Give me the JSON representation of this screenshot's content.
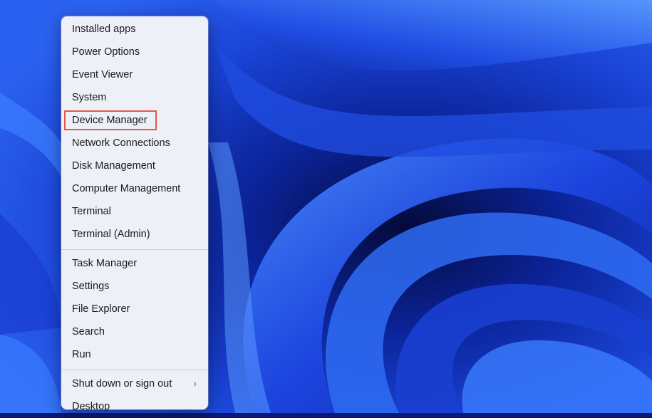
{
  "context_menu": {
    "group_1": [
      {
        "label": "Installed apps"
      },
      {
        "label": "Power Options"
      },
      {
        "label": "Event Viewer"
      },
      {
        "label": "System"
      },
      {
        "label": "Device Manager"
      },
      {
        "label": "Network Connections"
      },
      {
        "label": "Disk Management"
      },
      {
        "label": "Computer Management"
      },
      {
        "label": "Terminal"
      },
      {
        "label": "Terminal (Admin)"
      }
    ],
    "group_2": [
      {
        "label": "Task Manager"
      },
      {
        "label": "Settings"
      },
      {
        "label": "File Explorer"
      },
      {
        "label": "Search"
      },
      {
        "label": "Run"
      }
    ],
    "group_3": [
      {
        "label": "Shut down or sign out",
        "submenu_icon": "chevron-right-icon"
      },
      {
        "label": "Desktop"
      }
    ],
    "highlighted_item": "Device Manager",
    "highlight_color": "#e8584a"
  },
  "wallpaper": {
    "name": "Windows 11 Bloom",
    "colors": [
      "#0a1a7a",
      "#1a3fd8",
      "#3a7cff"
    ]
  }
}
